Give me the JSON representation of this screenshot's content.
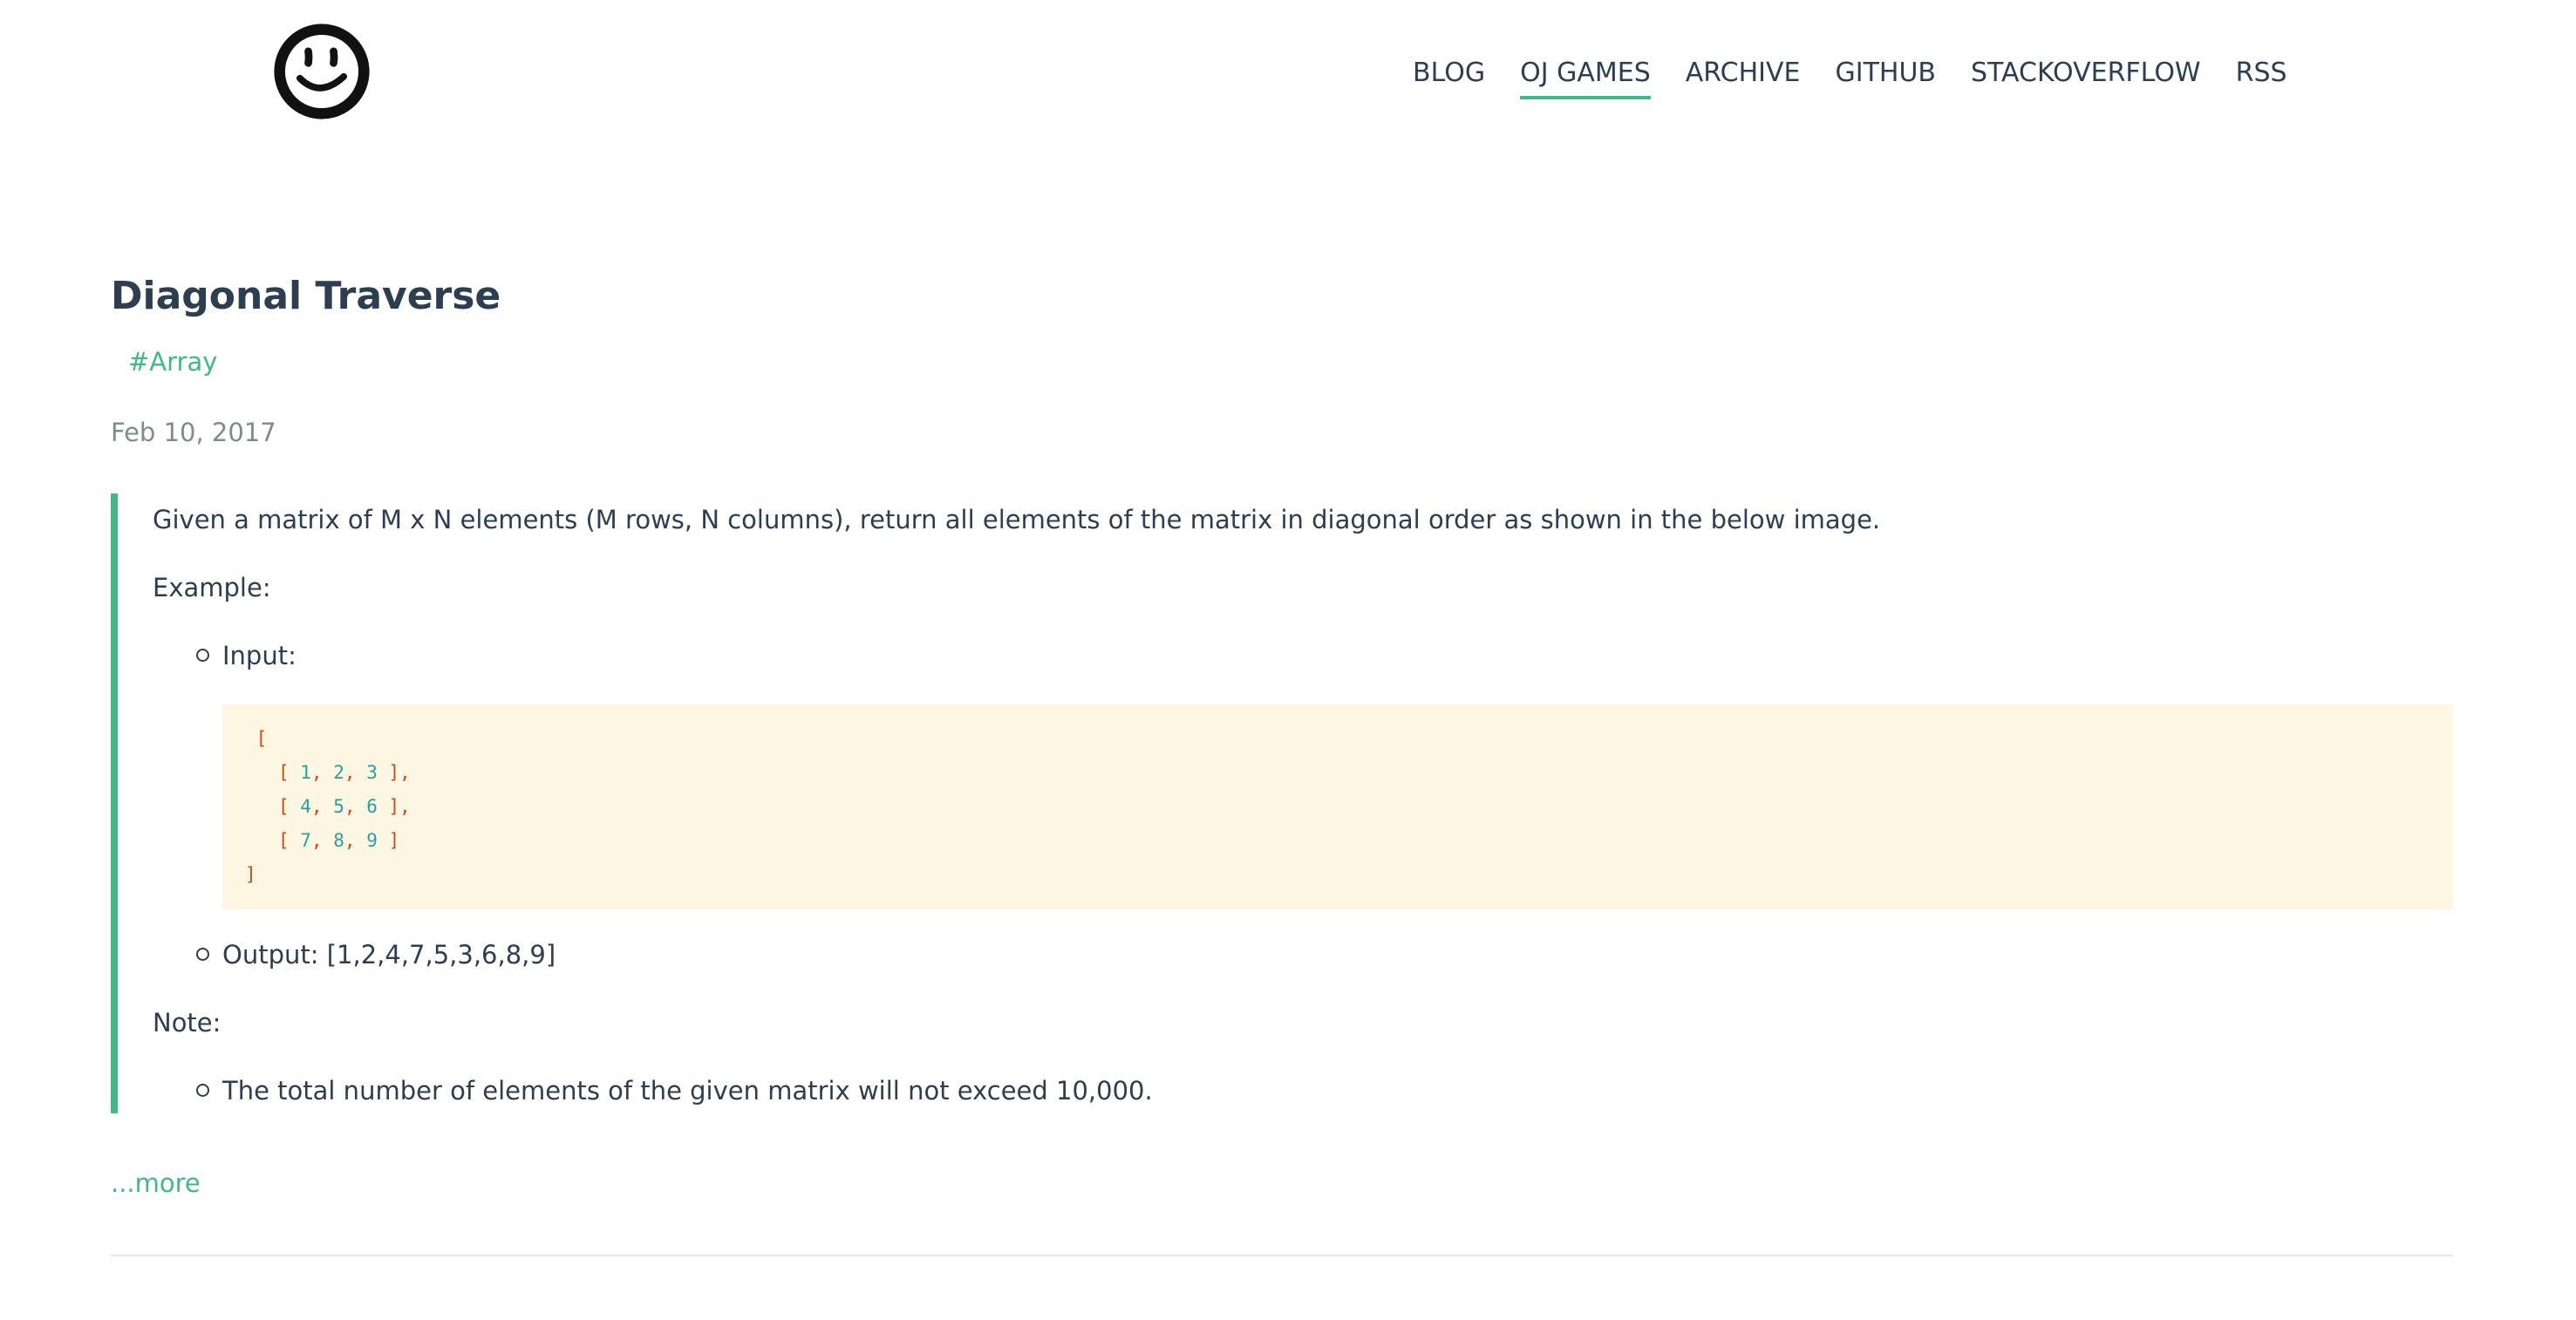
{
  "logo": {
    "icon": "smiley-face-icon"
  },
  "nav": {
    "items": [
      {
        "label": "BLOG",
        "active": false
      },
      {
        "label": "OJ GAMES",
        "active": true
      },
      {
        "label": "ARCHIVE",
        "active": false
      },
      {
        "label": "GITHUB",
        "active": false
      },
      {
        "label": "STACKOVERFLOW",
        "active": false
      },
      {
        "label": "RSS",
        "active": false
      }
    ]
  },
  "post": {
    "title": "Diagonal Traverse",
    "tag": "#Array",
    "date": "Feb 10, 2017",
    "description": "Given a matrix of M x N elements (M rows, N columns), return all elements of the matrix in diagonal order as shown in the below image.",
    "example_label": "Example:",
    "input_label": "Input:",
    "input_matrix": [
      [
        1,
        2,
        3
      ],
      [
        4,
        5,
        6
      ],
      [
        7,
        8,
        9
      ]
    ],
    "output_label": "Output: [1,2,4,7,5,3,6,8,9]",
    "note_label": "Note:",
    "note_text": "The total number of elements of the given matrix will not exceed 10,000.",
    "more_link": "...more"
  },
  "colors": {
    "accent": "#42b983",
    "text": "#2c3e50",
    "muted": "#7f8c8d",
    "code_bg": "#fdf6e3",
    "bracket": "#cb4b16",
    "number": "#2aa198"
  }
}
